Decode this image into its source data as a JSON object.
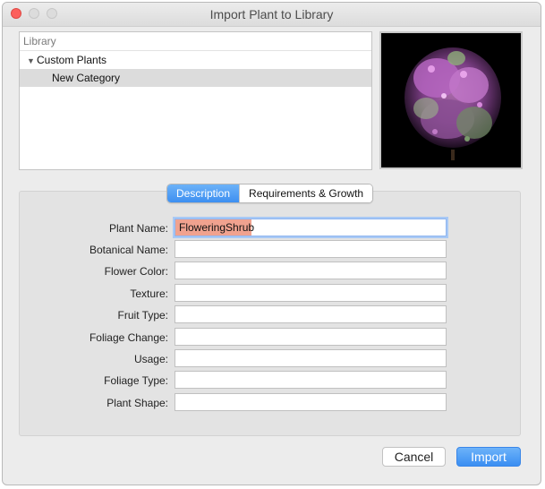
{
  "window": {
    "title": "Import Plant to Library"
  },
  "library": {
    "header": "Library",
    "items": [
      {
        "label": "Custom Plants",
        "expanded": true
      },
      {
        "label": "New Category",
        "selected": true
      }
    ]
  },
  "preview": {
    "icon": "plant-preview-thumbnail"
  },
  "tabs": [
    {
      "label": "Description",
      "active": true
    },
    {
      "label": "Requirements & Growth",
      "active": false
    }
  ],
  "form": {
    "fields": [
      {
        "label": "Plant Name:",
        "value": "FloweringShrub"
      },
      {
        "label": "Botanical Name:",
        "value": ""
      },
      {
        "label": "Flower Color:",
        "value": ""
      },
      {
        "label": "Texture:",
        "value": ""
      },
      {
        "label": "Fruit Type:",
        "value": ""
      },
      {
        "label": "Foliage Change:",
        "value": ""
      },
      {
        "label": "Usage:",
        "value": ""
      },
      {
        "label": "Foliage Type:",
        "value": ""
      },
      {
        "label": "Plant Shape:",
        "value": ""
      }
    ]
  },
  "buttons": {
    "cancel": "Cancel",
    "import": "Import"
  },
  "colors": {
    "accent": "#3d8ff1",
    "selection": "#f0a28f",
    "close": "#fc605c"
  }
}
